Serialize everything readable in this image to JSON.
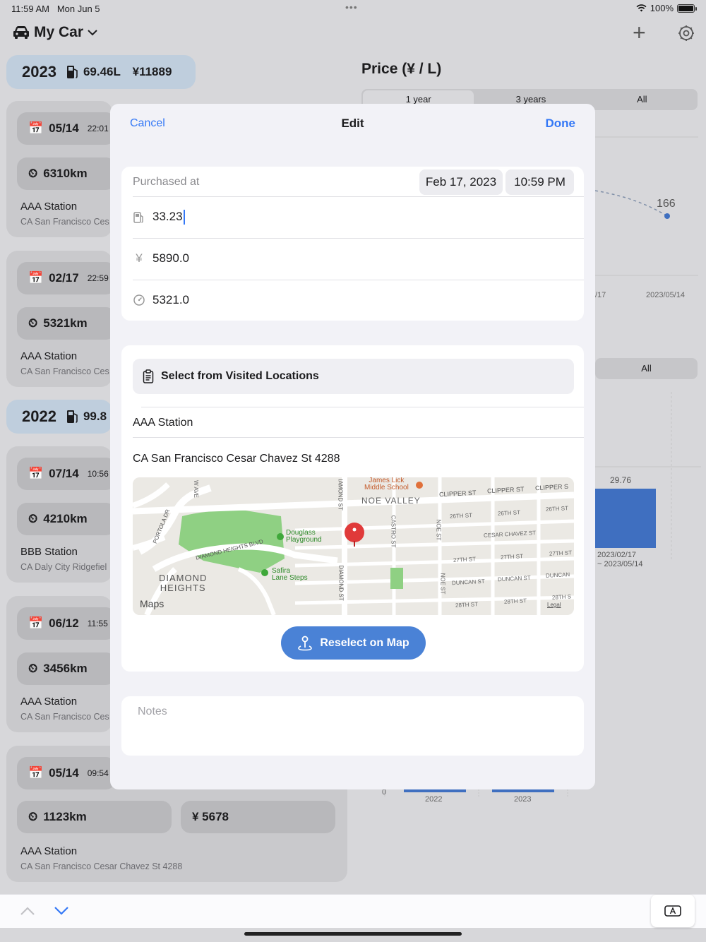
{
  "status": {
    "time": "11:59 AM",
    "date": "Mon Jun 5",
    "battery": "100%"
  },
  "nav": {
    "title": "My Car",
    "add_icon": "plus-icon",
    "settings_icon": "gear-icon"
  },
  "list": {
    "years": [
      {
        "year": "2023",
        "fuel": "69.46L",
        "cost": "¥11889"
      },
      {
        "year": "2022",
        "fuel": "99.8"
      }
    ],
    "entries": [
      {
        "date": "05/14",
        "time": "22:01",
        "odo": "6310km",
        "station": "AAA Station",
        "address": "CA San Francisco Ces"
      },
      {
        "date": "02/17",
        "time": "22:59",
        "odo": "5321km",
        "station": "AAA Station",
        "address": "CA San Francisco Ces"
      },
      {
        "date": "07/14",
        "time": "10:56",
        "odo": "4210km",
        "station": "BBB Station",
        "address": "CA Daly City Ridgefiel"
      },
      {
        "date": "06/12",
        "time": "11:55",
        "odo": "3456km",
        "station": "AAA Station",
        "address": "CA San Francisco Ces"
      },
      {
        "date": "05/14",
        "time": "09:54",
        "odo": "1123km",
        "price": "¥  5678",
        "station": "AAA Station",
        "address": "CA San Francisco Cesar Chavez St 4288"
      }
    ]
  },
  "right": {
    "title": "Price  (¥ / L)",
    "segments": [
      "1 year",
      "3 years",
      "All"
    ],
    "point_label": "166",
    "axis_dates": [
      "/17",
      "2023/05/14"
    ],
    "seg2_all": "All",
    "bar_value": "29.76",
    "bar_range": [
      "2023/02/17",
      "~ 2023/05/14"
    ],
    "bottom_zero": "0",
    "bottom_years": [
      "2022",
      "2023"
    ]
  },
  "modal": {
    "cancel": "Cancel",
    "title": "Edit",
    "done": "Done",
    "purchased_label": "Purchased at",
    "date": "Feb 17, 2023",
    "time": "10:59 PM",
    "fuel": "33.23",
    "price": "5890.0",
    "odometer": "5321.0",
    "select_visited": "Select from Visited Locations",
    "station": "AAA Station",
    "address": "CA San Francisco Cesar Chavez St 4288",
    "map_labels": {
      "school": "James Lick\nMiddle School",
      "noe_valley": "NOE VALLEY",
      "clipper1": "CLIPPER ST",
      "clipper2": "CLIPPER ST",
      "clipper3": "CLIPPER S",
      "douglass": "Douglass\nPlayground",
      "diamond_heights": "DIAMOND\nHEIGHTS",
      "safira": "Safira\nLane Steps",
      "cesar": "CESAR CHAVEZ ST",
      "st26a": "26TH ST",
      "st26b": "26TH ST",
      "st26c": "26TH ST",
      "st27a": "27TH ST",
      "st27b": "27TH ST",
      "st27c": "27TH ST",
      "duncan1": "DUNCAN ST",
      "duncan2": "DUNCAN ST",
      "duncan3": "DUNCAN",
      "st28a": "28TH ST",
      "st28b": "28TH ST",
      "st28c": "28TH S",
      "diamond_st": "DIAMOND ST",
      "iamond_st": "IAMOND ST",
      "castro": "CASTRO ST",
      "noe1": "NOE ST",
      "noe2": "NOE ST",
      "portola": "PORTOLA DR",
      "w_ave": "W AVE",
      "dh_blvd": "DIAMOND HEIGHTS BLVD",
      "maps": "Maps",
      "legal": "Legal"
    },
    "reselect": "Reselect on Map",
    "notes_placeholder": "Notes"
  }
}
